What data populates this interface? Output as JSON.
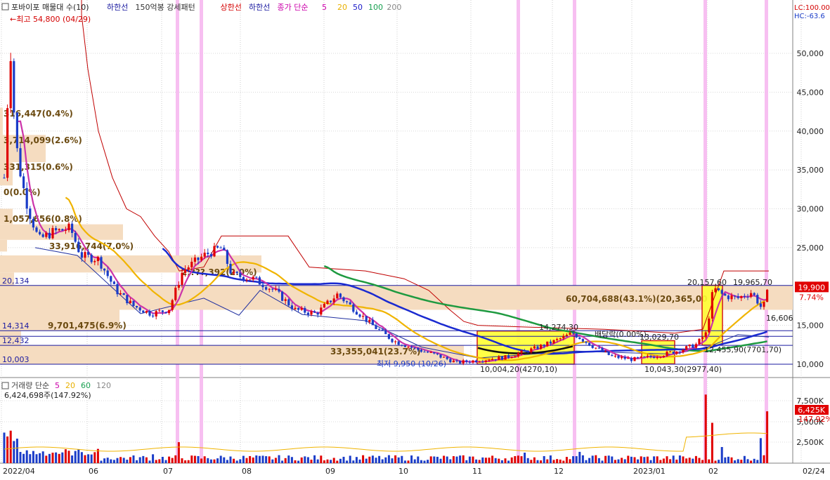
{
  "header": {
    "checkbox_label": "포바이포 매물대 수(10)",
    "items": [
      {
        "label": "하한선",
        "color": "#1a1aa0"
      },
      {
        "label": "150억봉 강세패턴",
        "color": "#333333"
      },
      {
        "label": "상한선",
        "color": "#d40000"
      },
      {
        "label": "하한선",
        "color": "#1a1aa0"
      },
      {
        "label": "종가 단순",
        "color": "#cc00aa"
      },
      {
        "label": "5",
        "color": "#cc00aa"
      },
      {
        "label": "20",
        "color": "#e8b000"
      },
      {
        "label": "50",
        "color": "#1a1ac8"
      },
      {
        "label": "100",
        "color": "#18a050"
      },
      {
        "label": "200",
        "color": "#888888"
      }
    ],
    "right_lc": "LC:100.00",
    "right_hc": "HC:-63.6"
  },
  "volume_header": {
    "label": "거래량 단순",
    "periods": [
      {
        "label": "5",
        "color": "#cc00aa"
      },
      {
        "label": "20",
        "color": "#e8b000"
      },
      {
        "label": "60",
        "color": "#18a050"
      },
      {
        "label": "120",
        "color": "#888888"
      }
    ],
    "volume_text": "6,424,698주(147.92%)"
  },
  "colors": {
    "up": "#e00000",
    "down": "#1a3cc8",
    "ma5": "#cc33aa",
    "ma20": "#f0b400",
    "ma50": "#1a2ad0",
    "ma100": "#1e9a40",
    "upper": "#c00000",
    "lower": "#2030a0",
    "highlight": "#f6b8f0",
    "profile": "#f5dcc0",
    "box": "#ffff33"
  },
  "chart_data": {
    "type": "candlestick",
    "price_axis": {
      "min": 8100,
      "max": 56000,
      "ticks": [
        "10,000",
        "15,000",
        "20,000",
        "25,000",
        "30,000",
        "35,000",
        "40,000",
        "45,000",
        "50,000"
      ]
    },
    "volume_axis": {
      "ticks": [
        "2,500K",
        "5,000K",
        "7,500K"
      ]
    },
    "x_labels": [
      "2022/04",
      "06",
      "07",
      "08",
      "09",
      "10",
      "11",
      "12",
      "2023/01",
      "02",
      "02/24"
    ],
    "annotations": {
      "high": "최고 54,800 (04/29)",
      "low": "최저 9,950 (10/26)",
      "box1_top": "14,274,30",
      "box1_bottom": "10,004,20(4270,10)",
      "box2_top": "13,029,70",
      "box2_bottom": "10,043,30(2977,40)",
      "box3_top_left": "20,157,60",
      "box3_top_right": "19,965,70",
      "box3_bottom": "12,455,90(7701,70)",
      "right_label": "16,606",
      "trend_label": "배당락(0.00%)"
    },
    "profile": [
      {
        "price": 20134,
        "label": "60,704,688(43.1%)(20,365,00"
      },
      {
        "price": 14314,
        "label": "9,701,475(6.9%)"
      },
      {
        "price": 12432,
        "label": "33,355,041(23.7%)"
      },
      {
        "price": 26500,
        "label": "33,916,744(7.0%)"
      },
      {
        "price": 29000,
        "label": "1,057,656(0.8%)"
      },
      {
        "price": 33000,
        "label": "0(0.0%)"
      },
      {
        "price": 35500,
        "label": "331,315(0.6%)"
      },
      {
        "price": 38000,
        "label": "3,714,099(2.6%)"
      },
      {
        "price": 41500,
        "label": "316,447(0.4%)"
      },
      {
        "price": 22800,
        "label": "2,???,392(2.0%)"
      }
    ],
    "levels": [
      {
        "value": 20134,
        "label": "20,134"
      },
      {
        "value": 14314,
        "label": "14,314"
      },
      {
        "value": 12432,
        "label": "12,432"
      },
      {
        "value": 10003,
        "label": "10,003"
      }
    ],
    "last_price": {
      "value": "19,900",
      "change": "7.74%"
    },
    "last_volume": {
      "value": "6,425K",
      "change": "147.92%"
    },
    "series_names": [
      "MA5",
      "MA20",
      "MA50",
      "MA100",
      "상한선",
      "하한선"
    ]
  }
}
